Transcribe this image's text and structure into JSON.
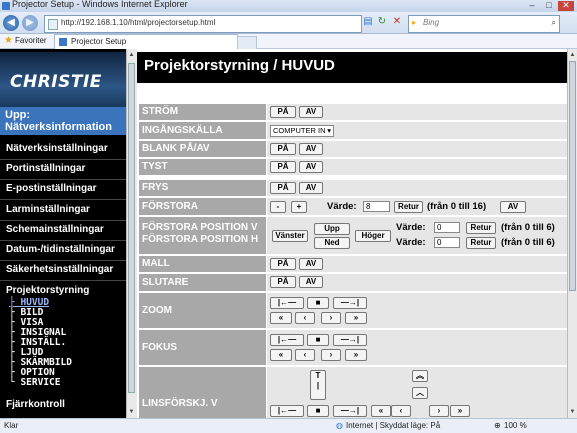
{
  "window": {
    "title": "Projector Setup - Windows Internet Explorer"
  },
  "browser": {
    "url": "http://192.168.1.10/html/projectorsetup.html",
    "search_placeholder": "Bing",
    "favorites_label": "Favoriter",
    "tab_label": "Projector Setup"
  },
  "sidebar": {
    "logo": "CHRISTIE",
    "upp_label": "Upp: Nätverksinformation",
    "items": [
      "Nätverksinställningar",
      "Portinställningar",
      "E-postinställningar",
      "Larminställningar",
      "Schemainställningar",
      "Datum-/tidinställningar",
      "Säkerhetsinställningar",
      "Projektorstyrning"
    ],
    "sub_items": [
      "├ HUVUD",
      "├ BILD",
      "├ VISA",
      "├ INSIGNAL",
      "├ INSTÄLL.",
      "├ LJUD",
      "├ SKÄRMBILD",
      "├ OPTION",
      "└ SERVICE"
    ],
    "bottom_item": "Fjärrkontroll"
  },
  "header": {
    "title": "Projektorstyrning / HUVUD"
  },
  "rows": {
    "strom": {
      "label": "STRÖM",
      "on": "PÅ",
      "off": "AV"
    },
    "ingang": {
      "label": "INGÅNGSKÄLLA",
      "value": "COMPUTER IN"
    },
    "blank": {
      "label": "BLANK PÅ/AV",
      "on": "PÅ",
      "off": "AV"
    },
    "tyst": {
      "label": "TYST",
      "on": "PÅ",
      "off": "AV"
    },
    "frys": {
      "label": "FRYS",
      "on": "PÅ",
      "off": "AV"
    },
    "forstora": {
      "label": "FÖRSTORA",
      "minus": "-",
      "plus": "+",
      "value_label": "Värde:",
      "value": "8",
      "return": "Retur",
      "range": "(från 0 till 16)",
      "off": "AV"
    },
    "forstora_pos": {
      "label_v": "FÖRSTORA POSITION V",
      "label_h": "FÖRSTORA POSITION H",
      "left": "Vänster",
      "up": "Upp",
      "down": "Ned",
      "right": "Höger",
      "value_label": "Värde:",
      "value_v": "0",
      "value_h": "0",
      "return": "Retur",
      "range_v": "(från 0 till 6)",
      "range_h": "(från 0 till 6)"
    },
    "mall": {
      "label": "MALL",
      "on": "PÅ",
      "off": "AV"
    },
    "slutare": {
      "label": "SLUTARE",
      "on": "PÅ",
      "off": "AV"
    },
    "zoom": {
      "label": "ZOOM"
    },
    "fokus": {
      "label": "FOKUS"
    },
    "lins": {
      "label": "LINSFÖRSKJ. V"
    }
  },
  "status": {
    "left": "Klar",
    "zone": "Internet | Skyddat läge: På",
    "zoom": "100 %"
  }
}
